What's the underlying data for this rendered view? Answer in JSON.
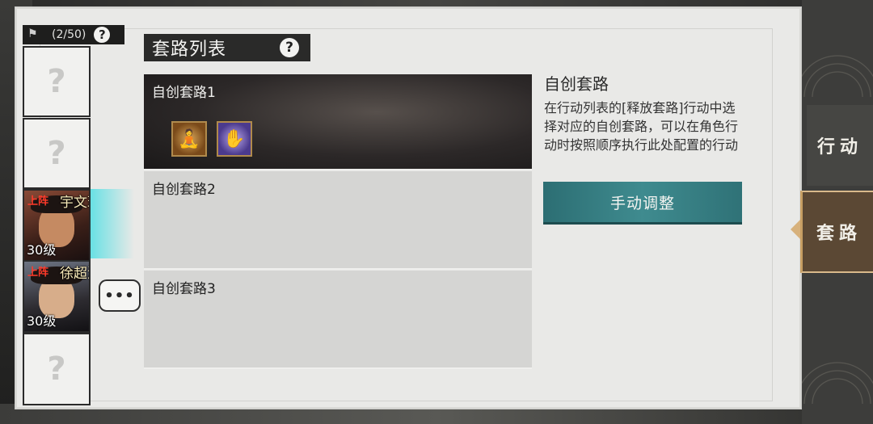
{
  "roster": {
    "count": "(2/50)",
    "help": "?",
    "empty_slot": "?",
    "heroes": [
      {
        "deploy": "上阵",
        "name": "宇文珂",
        "level": "30级"
      },
      {
        "deploy": "上阵",
        "name": "徐超渊",
        "level": "30级"
      }
    ],
    "chat": "•••"
  },
  "list": {
    "title": "套路列表",
    "help": "?",
    "routines": [
      {
        "label": "自创套路1"
      },
      {
        "label": "自创套路2"
      },
      {
        "label": "自创套路3"
      }
    ]
  },
  "info": {
    "title": "自创套路",
    "description": "在行动列表的[释放套路]行动中选择对应的自创套路，可以在角色行动时按照顺序执行此处配置的行动",
    "button": "手动调整"
  },
  "tabs": {
    "action": "行动",
    "routine": "套路"
  },
  "colors": {
    "accent_teal": "#3f8b8f",
    "deploy_red": "#ff3b2b",
    "active_tab": "#5b4834"
  }
}
